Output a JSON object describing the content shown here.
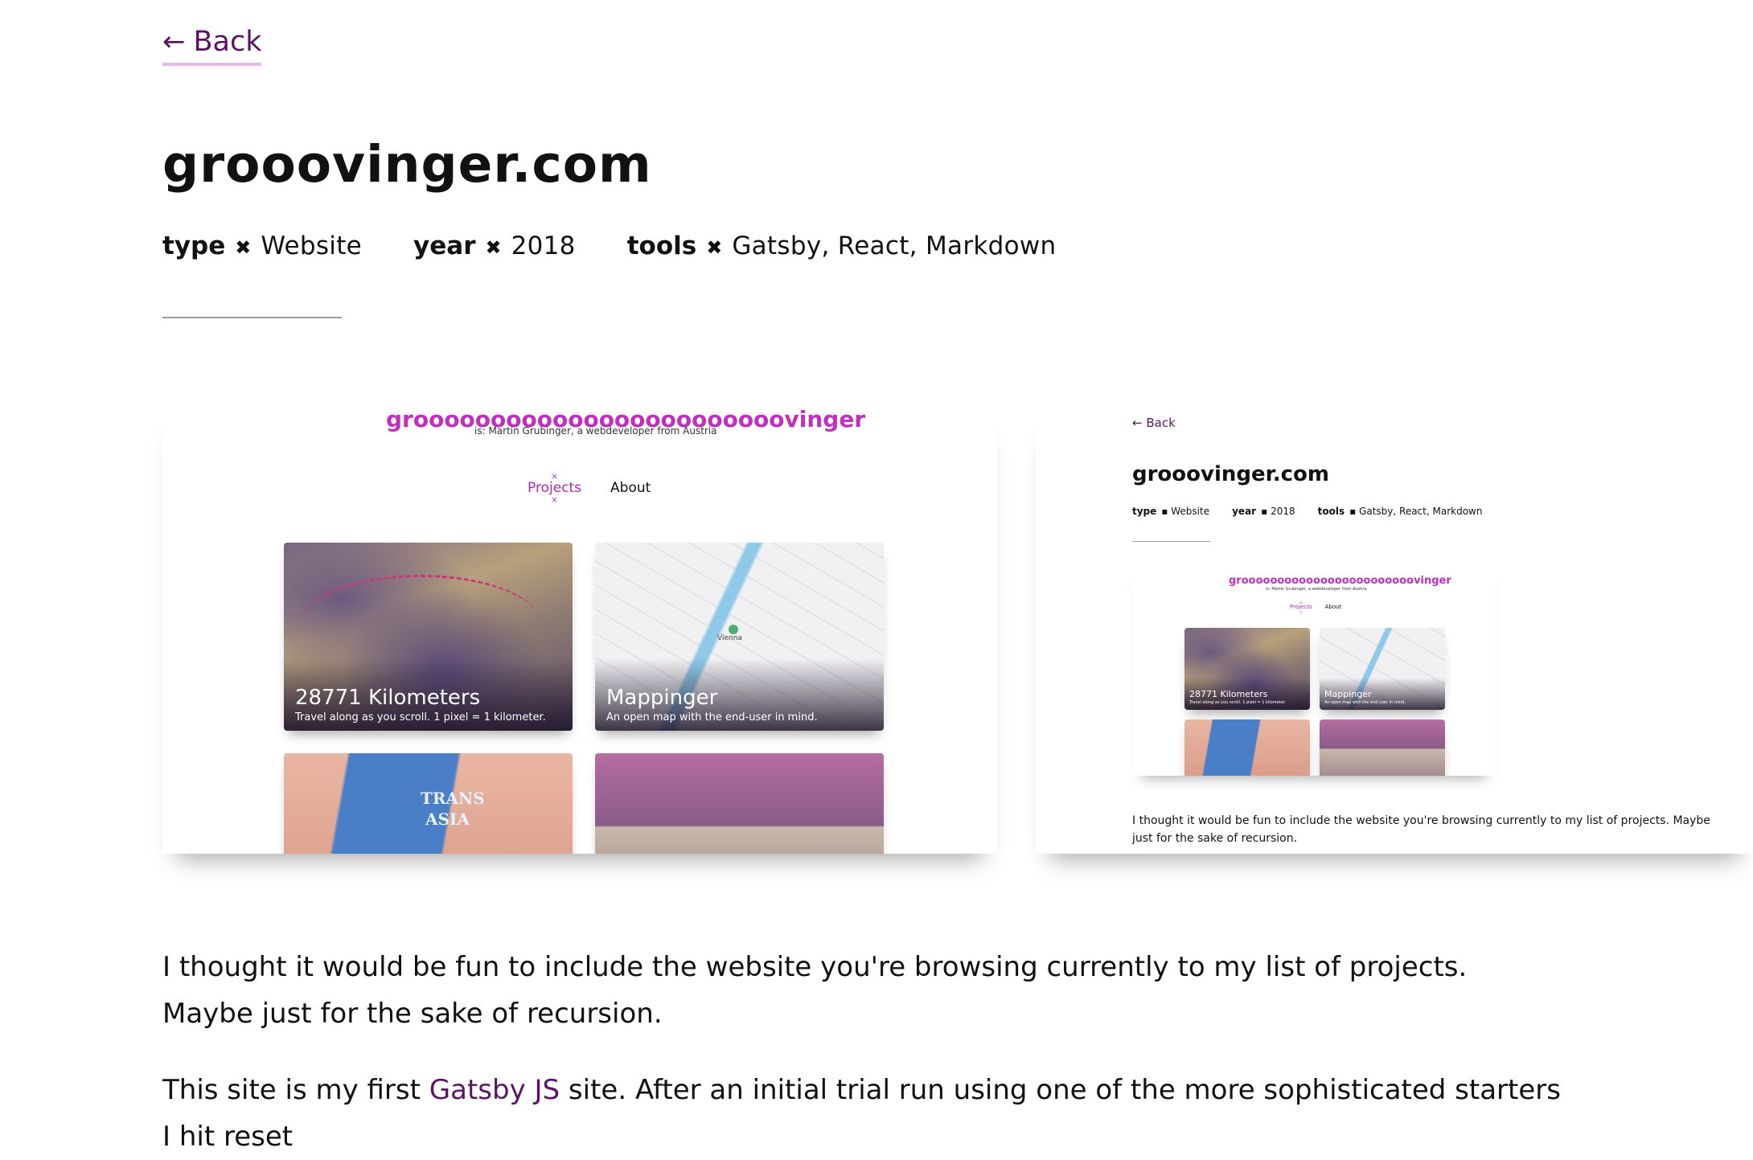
{
  "nav": {
    "back_arrow": "←",
    "back_label": "Back"
  },
  "project": {
    "title": "grooovinger.com",
    "meta": [
      {
        "key": "type",
        "sep": "✖",
        "value": "Website"
      },
      {
        "key": "year",
        "sep": "✖",
        "value": "2018"
      },
      {
        "key": "tools",
        "sep": "✖",
        "value": "Gatsby, React, Markdown"
      }
    ]
  },
  "gallery": {
    "shot1": {
      "logo": "groooooooooooooooooooooooovinger",
      "subtitle": "is: Martin Grubinger, a webdeveloper from Austria",
      "nav": [
        "Projects",
        "About"
      ],
      "cards": [
        {
          "title": "28771 Kilometers",
          "desc": "Travel along as you scroll. 1 pixel = 1 kilometer."
        },
        {
          "title": "Mappinger",
          "desc": "An open map with the end-user in mind."
        }
      ],
      "map_pin_label": "Vienna",
      "book_text_1": "TRANS",
      "book_text_2": "ASIA"
    },
    "shot2": {
      "back_label": "← Back",
      "title": "grooovinger.com",
      "meta": [
        {
          "key": "type",
          "sep": "▪",
          "value": "Website"
        },
        {
          "key": "year",
          "sep": "▪",
          "value": "2018"
        },
        {
          "key": "tools",
          "sep": "▪",
          "value": "Gatsby, React, Markdown"
        }
      ],
      "inner_logo": "groooooooooooooooooooooooovinger",
      "inner_subtitle": "is: Martin Grubinger, a webdeveloper from Austria",
      "inner_nav": [
        "Projects",
        "About"
      ],
      "inner_cards": [
        {
          "title": "28771 Kilometers",
          "desc": "Travel along as you scroll. 1 pixel = 1 kilometer."
        },
        {
          "title": "Mappinger",
          "desc": "An open map with the end-user in mind."
        }
      ],
      "paragraph": "I thought it would be fun to include the website you're browsing currently to my list of projects. Maybe just for the sake of recursion."
    }
  },
  "content": {
    "paragraph1": "I thought it would be fun to include the website you're browsing currently to my list of projects. Maybe just for the sake of recursion.",
    "paragraph2_before": "This site is my first ",
    "paragraph2_link": "Gatsby JS",
    "paragraph2_after": " site. After an initial trial run using one of the more sophisticated starters I hit reset"
  }
}
